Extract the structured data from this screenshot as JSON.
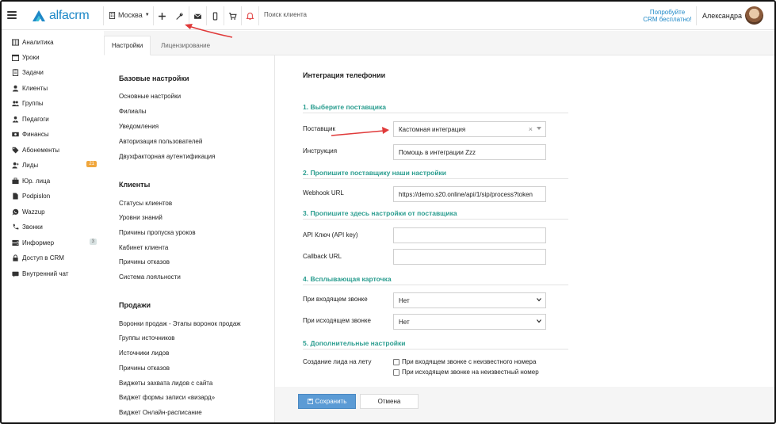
{
  "colors": {
    "brand": "#1e88c7",
    "step": "#2a9d8f",
    "save": "#5b9bd5",
    "annotation": "#e03a3a",
    "badge_orange": "#f0a63c"
  },
  "header": {
    "logo_text": "alfacrm",
    "city": "Москва",
    "search_placeholder": "Поиск клиента",
    "promo_line1": "Попробуйте",
    "promo_line2": "CRM бесплатно!",
    "user_name": "Александра",
    "icons": [
      "plus-icon",
      "wrench-icon",
      "mail-icon",
      "phone-icon",
      "cart-icon",
      "bell-icon"
    ]
  },
  "sidebar": {
    "items": [
      {
        "label": "Аналитика",
        "icon": "chart-icon"
      },
      {
        "label": "Уроки",
        "icon": "calendar-icon"
      },
      {
        "label": "Задачи",
        "icon": "clipboard-icon"
      },
      {
        "label": "Клиенты",
        "icon": "user-icon"
      },
      {
        "label": "Группы",
        "icon": "users-icon"
      },
      {
        "label": "Педагоги",
        "icon": "teacher-icon"
      },
      {
        "label": "Финансы",
        "icon": "money-icon"
      },
      {
        "label": "Абонементы",
        "icon": "tag-icon"
      },
      {
        "label": "Лиды",
        "icon": "user-plus-icon",
        "badge": "21"
      },
      {
        "label": "Юр. лица",
        "icon": "briefcase-icon"
      },
      {
        "label": "Podpislon",
        "icon": "file-icon"
      },
      {
        "label": "Wazzup",
        "icon": "whatsapp-icon"
      },
      {
        "label": "Звонки",
        "icon": "phone-icon"
      },
      {
        "label": "Информер",
        "icon": "server-icon",
        "badge": "3"
      },
      {
        "label": "Доступ в CRM",
        "icon": "lock-icon"
      },
      {
        "label": "Внутренний чат",
        "icon": "chat-icon"
      }
    ]
  },
  "tabs": [
    "Настройки",
    "Лицензирование"
  ],
  "settings_menu": {
    "basic": {
      "title": "Базовые настройки",
      "links": [
        "Основные настройки",
        "Филиалы",
        "Уведомления",
        "Авторизация пользователей",
        "Двухфакторная аутентификация"
      ]
    },
    "clients": {
      "title": "Клиенты",
      "links": [
        "Статусы клиентов",
        "Уровни знаний",
        "Причины пропуска уроков",
        "Кабинет клиента",
        "Причины отказов",
        "Система лояльности"
      ]
    },
    "sales": {
      "title": "Продажи",
      "links": [
        "Воронки продаж - Этапы воронок продаж",
        "Группы источников",
        "Источники лидов",
        "Причины отказов",
        "Виджеты захвата лидов с сайта",
        "Виджет формы записи «визард»",
        "Виджет Онлайн-расписание"
      ]
    }
  },
  "main": {
    "title": "Интеграция телефонии",
    "step1": "1. Выберите поставщика",
    "provider_label": "Поставщик",
    "provider_value": "Кастомная интеграция",
    "instruction_label": "Инструкция",
    "instruction_value": "Помощь в интеграции Zzz",
    "step2": "2. Пропишите поставщику наши настройки",
    "webhook_label": "Webhook URL",
    "webhook_value": "https://demo.s20.online/api/1/sip/process?token",
    "step3": "3. Пропишите здесь настройки от поставщика",
    "api_key_label": "API Ключ (API key)",
    "api_key_value": "",
    "callback_label": "Callback URL",
    "callback_value": "",
    "step4": "4. Всплывающая карточка",
    "incoming_label": "При входящем звонке",
    "incoming_value": "Нет",
    "outgoing_label": "При исходящем звонке",
    "outgoing_value": "Нет",
    "step5": "5. Дополнительные настройки",
    "lead_label": "Создание лида на лету",
    "chk_incoming": "При входящем звонке с неизвестного номера",
    "chk_outgoing": "При исходящем звонке на неизвестный номер",
    "save_label": "Сохранить",
    "cancel_label": "Отмена"
  }
}
